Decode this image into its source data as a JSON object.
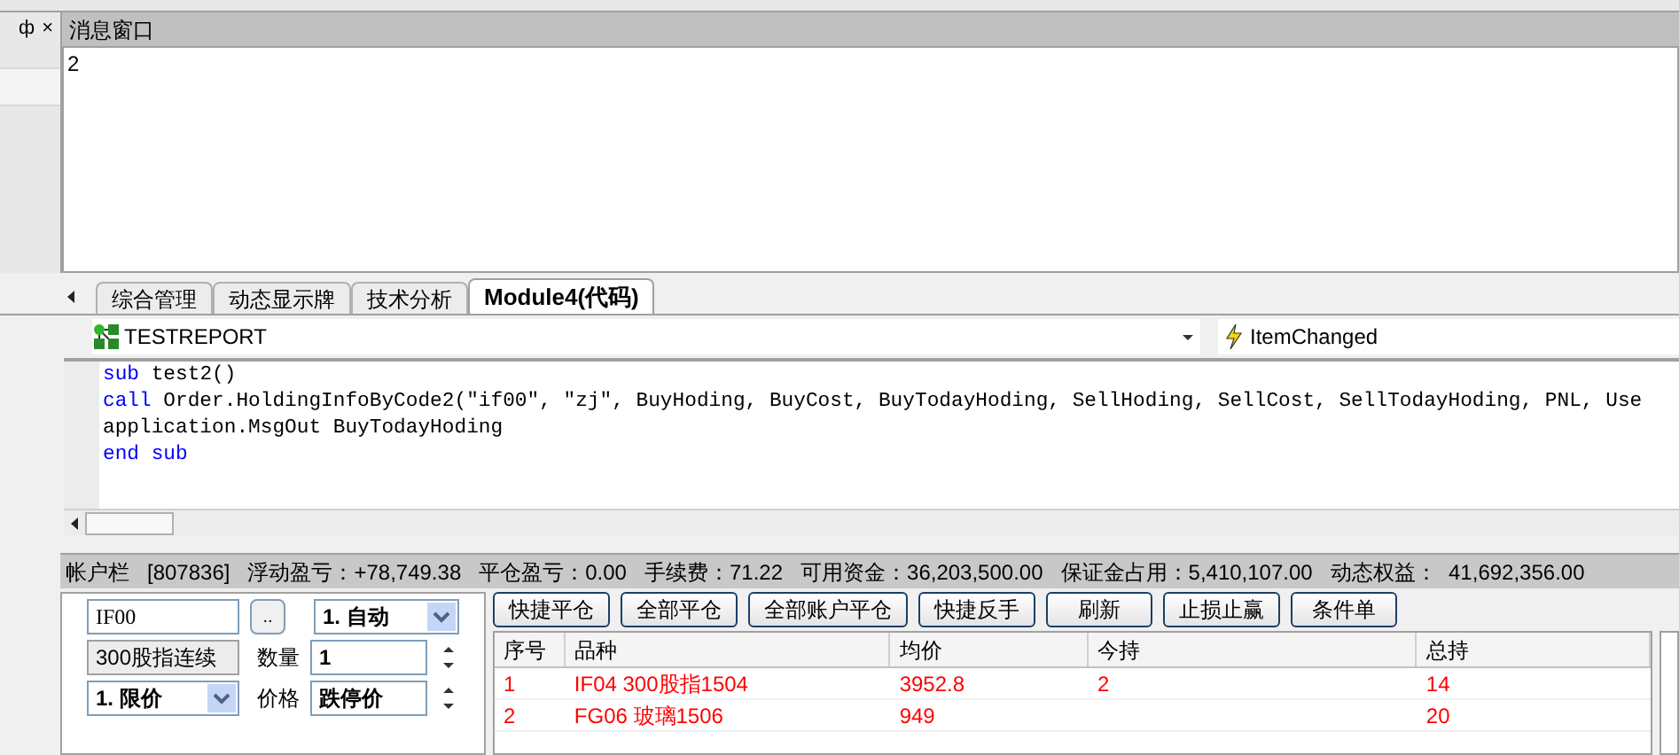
{
  "left_panel": {
    "pin_glyph": "ф",
    "close_glyph": "×"
  },
  "message_window": {
    "title": "消息窗口",
    "content": "2"
  },
  "tabs": [
    {
      "label": "综合管理",
      "selected": false
    },
    {
      "label": "动态显示牌",
      "selected": false
    },
    {
      "label": "技术分析",
      "selected": false
    },
    {
      "label": "Module4(代码)",
      "selected": true
    }
  ],
  "editor": {
    "object": "TESTREPORT",
    "event": "ItemChanged",
    "lines": [
      [
        {
          "text": "sub",
          "kind": "keyword"
        },
        {
          "text": " test2()",
          "kind": "plain"
        }
      ],
      [
        {
          "text": "call",
          "kind": "keyword"
        },
        {
          "text": " Order.HoldingInfoByCode2(″if00″, ″zj″, BuyHoding, BuyCost, BuyTodayHoding, SellHoding, SellCost, SellTodayHoding, PNL, Use",
          "kind": "plain"
        }
      ],
      [
        {
          "text": "application.MsgOut BuyTodayHoding",
          "kind": "plain"
        }
      ],
      [
        {
          "text": "end sub",
          "kind": "keyword"
        }
      ]
    ]
  },
  "account_bar": [
    "帐户栏",
    "[807836]",
    "浮动盈亏：+78,749.38",
    "平仓盈亏：0.00",
    "手续费：71.22",
    "可用资金：36,203,500.00",
    "保证金占用：5,410,107.00",
    "动态权益：  41,692,356.00"
  ],
  "order_form": {
    "code": "IF00",
    "browse": "..",
    "mode": "1. 自动",
    "name": "300股指连续",
    "qty_label": "数量",
    "qty": "1",
    "price_type": "1. 限价",
    "price_label": "价格",
    "price": "跌停价"
  },
  "buttons": [
    "快捷平仓",
    "全部平仓",
    "全部账户平仓",
    "快捷反手",
    "刷新",
    "止损止赢",
    "条件单"
  ],
  "table": {
    "columns": [
      "序号",
      "品种",
      "均价",
      "今持",
      "总持"
    ],
    "rows": [
      [
        "1",
        "IF04 300股指1504",
        "3952.8",
        "2",
        "14"
      ],
      [
        "2",
        "FG06 玻璃1506",
        "949",
        "",
        "20"
      ]
    ]
  }
}
